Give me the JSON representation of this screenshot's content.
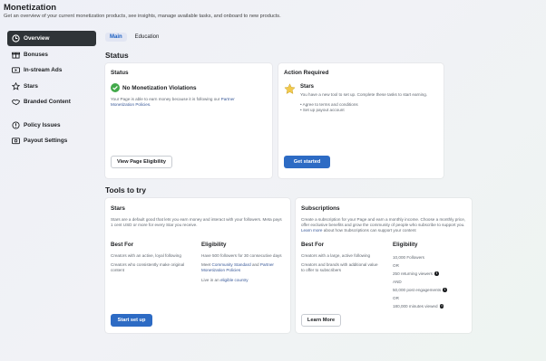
{
  "header": {
    "title": "Monetization",
    "subtitle": "Get an overview of your current monetization products, see insights, manage available tasks, and onboard to new products."
  },
  "sidebar": {
    "items": [
      {
        "label": "Overview",
        "icon": "clock-icon"
      },
      {
        "label": "Bonuses",
        "icon": "gift-icon"
      },
      {
        "label": "In-stream Ads",
        "icon": "video-icon"
      },
      {
        "label": "Stars",
        "icon": "star-icon"
      },
      {
        "label": "Branded Content",
        "icon": "handshake-icon"
      },
      {
        "label": "Policy Issues",
        "icon": "alert-icon"
      },
      {
        "label": "Payout Settings",
        "icon": "payout-icon"
      }
    ]
  },
  "tabs": [
    {
      "label": "Main"
    },
    {
      "label": "Education"
    }
  ],
  "status_section": {
    "heading": "Status",
    "status_card": {
      "title": "Status",
      "violation_title": "No Monetization Violations",
      "body": "Your Page is able to earn money because it is following our",
      "link": "Partner Monetization Policies.",
      "button": "View Page Eligibility"
    },
    "action_card": {
      "title": "Action Required",
      "product": "Stars",
      "body": "You have a new tool to set up. Complete these tasks to start earning.",
      "tasks": [
        "Agree to terms and conditions",
        "Set up payout account"
      ],
      "button": "Get started"
    }
  },
  "tools_section": {
    "heading": "Tools to try",
    "stars_card": {
      "title": "Stars",
      "description": "Stars are a default good that lets you earn money and interact with your followers. Meta pays 1 cent USD or more for every Star you receive.",
      "best_for_heading": "Best For",
      "best_for": [
        "Creators with an active, loyal following",
        "Creators who consistently make original content"
      ],
      "eligibility_heading": "Eligibility",
      "eligibility_1": "Have 500 followers for 30 consecutive days",
      "eligibility_2_prefix": "Meet",
      "eligibility_2_link1": "Community Standard",
      "eligibility_2_mid": "and",
      "eligibility_2_link2": "Partner Monetization Policies",
      "eligibility_3_prefix": "Live in an",
      "eligibility_3_link": "eligible country",
      "button": "Start set up"
    },
    "subscriptions_card": {
      "title": "Subscriptions",
      "description_prefix": "Create a subscription for your Page and earn a monthly income. Choose a monthly price, offer exclusive benefits and grow the community of people who subscribe to support you.",
      "description_link": "Learn more",
      "description_suffix": "about how Subscriptions can support your content",
      "best_for_heading": "Best For",
      "best_for": [
        "Creators with a large, active following",
        "Creators and brands with additional value to offer to subscribers"
      ],
      "eligibility_heading": "Eligibility",
      "eligibility": {
        "followers": "10,000 Followers",
        "or1": "OR",
        "viewers": "250 returning viewers",
        "and": "AND",
        "engagements": "50,000 post engagements",
        "or2": "OR",
        "minutes": "180,000 minutes viewed"
      },
      "button": "Learn More"
    }
  },
  "colors": {
    "primary_button": "#2d6bc4",
    "active_nav": "#2f3438",
    "success_green": "#42a94a",
    "link": "#385898"
  }
}
